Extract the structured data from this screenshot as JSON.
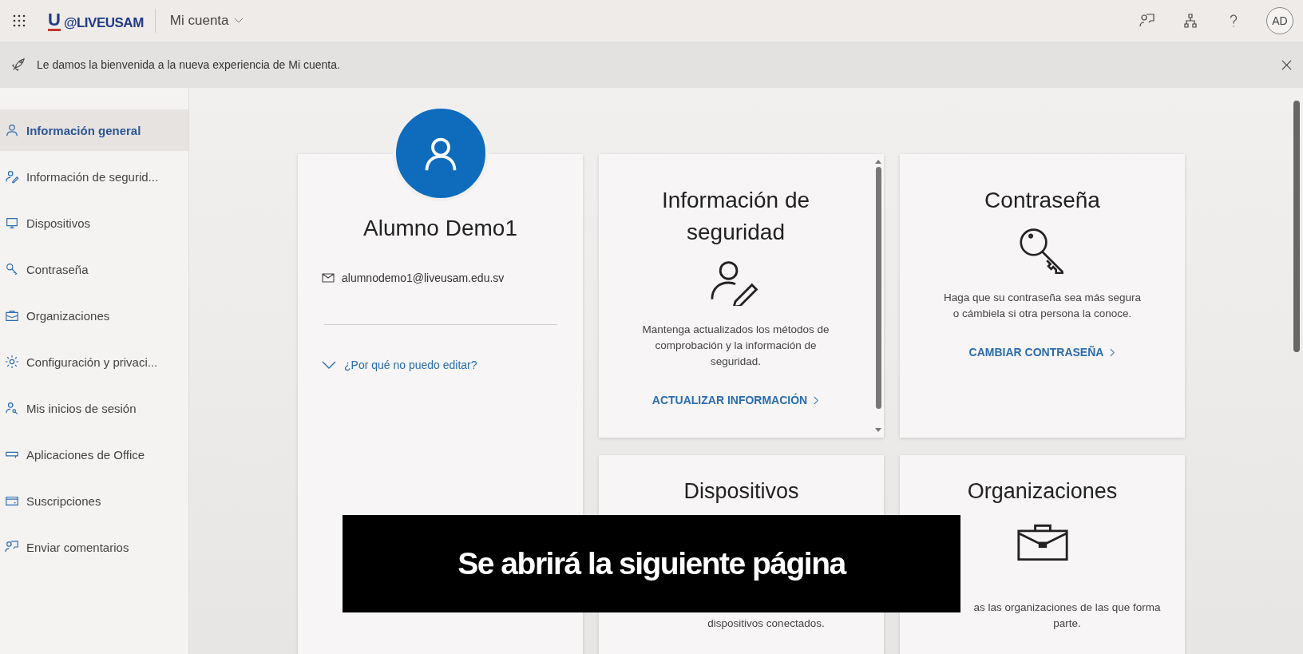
{
  "header": {
    "logo_mark": "U",
    "logo_text": "@LIVEUSAM",
    "title": "Mi cuenta",
    "avatar_initials": "AD"
  },
  "banner": {
    "message": "Le damos la bienvenida a la nueva experiencia de Mi cuenta."
  },
  "sidebar": {
    "items": [
      {
        "label": "Información general",
        "selected": true
      },
      {
        "label": "Información de segurid...",
        "selected": false
      },
      {
        "label": "Dispositivos",
        "selected": false
      },
      {
        "label": "Contraseña",
        "selected": false
      },
      {
        "label": "Organizaciones",
        "selected": false
      },
      {
        "label": "Configuración y privaci...",
        "selected": false
      },
      {
        "label": "Mis inicios de sesión",
        "selected": false
      },
      {
        "label": "Aplicaciones de Office",
        "selected": false
      },
      {
        "label": "Suscripciones",
        "selected": false
      },
      {
        "label": "Enviar comentarios",
        "selected": false
      }
    ]
  },
  "profile": {
    "name": "Alumno Demo1",
    "email": "alumnodemo1@liveusam.edu.sv",
    "help_link": "¿Por qué no puedo editar?"
  },
  "cards": [
    {
      "title": "Información de seguridad",
      "description": "Mantenga actualizados los métodos de comprobación y la información de seguridad.",
      "action": "ACTUALIZAR INFORMACIÓN"
    },
    {
      "title": "Contraseña",
      "description": "Haga que su contraseña sea más segura o cámbiela si otra persona la conoce.",
      "action": "CAMBIAR CONTRASEÑA"
    },
    {
      "title": "Dispositivos",
      "description": "dispositivos conectados."
    },
    {
      "title": "Organizaciones",
      "description": "as las organizaciones de las que forma parte."
    }
  ],
  "caption": "Se abrirá la siguiente página"
}
